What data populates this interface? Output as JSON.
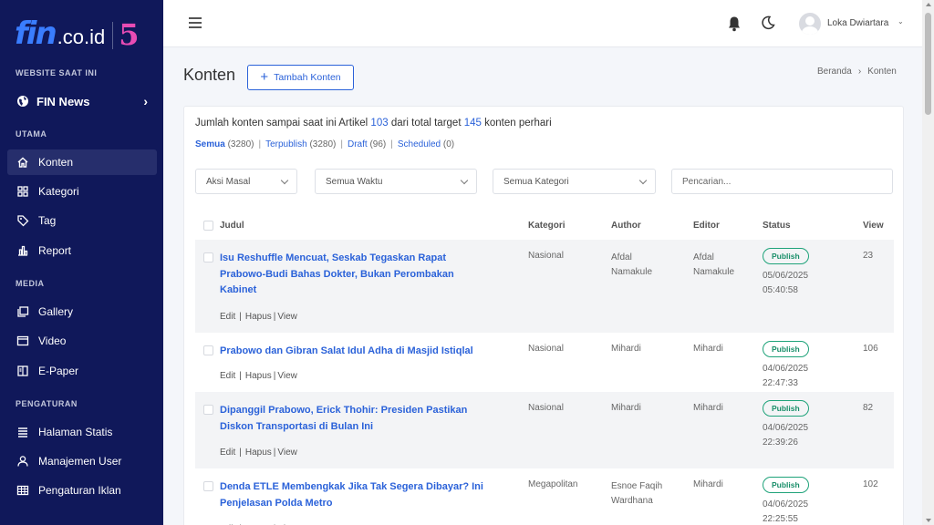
{
  "sidebar": {
    "logo": {
      "fin": "fin",
      "domain": ".co.id",
      "anniversary": "5"
    },
    "website_label": "WEBSITE SAAT INI",
    "site_name": "FIN News",
    "sections": {
      "utama": "UTAMA",
      "media": "MEDIA",
      "pengaturan": "PENGATURAN"
    },
    "items": [
      {
        "label": "Konten",
        "icon": "home-icon"
      },
      {
        "label": "Kategori",
        "icon": "grid-icon"
      },
      {
        "label": "Tag",
        "icon": "tag-icon"
      },
      {
        "label": "Report",
        "icon": "chart-icon"
      },
      {
        "label": "Gallery",
        "icon": "gallery-icon"
      },
      {
        "label": "Video",
        "icon": "video-icon"
      },
      {
        "label": "E-Paper",
        "icon": "book-icon"
      },
      {
        "label": "Halaman Statis",
        "icon": "list-icon"
      },
      {
        "label": "Manajemen User",
        "icon": "user-icon"
      },
      {
        "label": "Pengaturan Iklan",
        "icon": "table-icon"
      }
    ]
  },
  "topbar": {
    "username": "Loka Dwiartara"
  },
  "header": {
    "title": "Konten",
    "add_button": "Tambah Konten",
    "breadcrumb": [
      "Beranda",
      "Konten"
    ]
  },
  "summary": {
    "prefix": "Jumlah konten sampai saat ini Artikel",
    "count": "103",
    "middle": "dari total target",
    "target": "145",
    "suffix": "konten perhari"
  },
  "status_filters": [
    {
      "label": "Semua",
      "count": "(3280)"
    },
    {
      "label": "Terpublish",
      "count": "(3280)"
    },
    {
      "label": "Draft",
      "count": "(96)"
    },
    {
      "label": "Scheduled",
      "count": "(0)"
    }
  ],
  "filters": {
    "bulk": "Aksi Masal",
    "time": "Semua Waktu",
    "category": "Semua Kategori",
    "search_placeholder": "Pencarian..."
  },
  "table": {
    "headers": {
      "judul": "Judul",
      "kategori": "Kategori",
      "author": "Author",
      "editor": "Editor",
      "status": "Status",
      "view": "View"
    },
    "actions": {
      "edit": "Edit",
      "hapus": "Hapus",
      "view": "View"
    },
    "rows": [
      {
        "title": "Isu Reshuffle Mencuat, Seskab Tegaskan Rapat Prabowo-Budi Bahas Dokter, Bukan Perombakan Kabinet",
        "kategori": "Nasional",
        "author": "Afdal Namakule",
        "editor": "Afdal Namakule",
        "status": "Publish",
        "date": "05/06/2025",
        "time": "05:40:58",
        "views": "23"
      },
      {
        "title": "Prabowo dan Gibran Salat Idul Adha di Masjid Istiqlal",
        "kategori": "Nasional",
        "author": "Mihardi",
        "editor": "Mihardi",
        "status": "Publish",
        "date": "04/06/2025",
        "time": "22:47:33",
        "views": "106"
      },
      {
        "title": "Dipanggil Prabowo, Erick Thohir: Presiden Pastikan Diskon Transportasi di Bulan Ini",
        "kategori": "Nasional",
        "author": "Mihardi",
        "editor": "Mihardi",
        "status": "Publish",
        "date": "04/06/2025",
        "time": "22:39:26",
        "views": "82"
      },
      {
        "title": "Denda ETLE Membengkak Jika Tak Segera Dibayar? Ini Penjelasan Polda Metro",
        "kategori": "Megapolitan",
        "author": "Esnoe Faqih Wardhana",
        "editor": "Mihardi",
        "status": "Publish",
        "date": "04/06/2025",
        "time": "22:25:55",
        "views": "102"
      }
    ]
  },
  "colors": {
    "sidebar_bg": "#10185a",
    "accent": "#2b62d9",
    "publish": "#1fa37a"
  }
}
